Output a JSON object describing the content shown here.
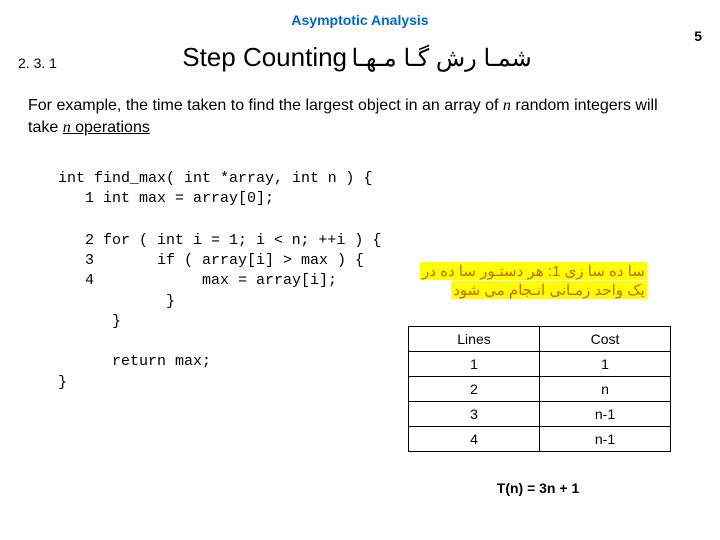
{
  "header": "Asymptotic Analysis",
  "page_number": "5",
  "section_number": "2. 3. 1",
  "title_en": "Step Counting",
  "title_fa": "شمـا رش گـا مـهـا",
  "body_prefix": "For example, the time taken to find the largest object in an array of ",
  "body_italic1": "n",
  "body_mid": " random integers will take ",
  "body_italic2": "n",
  "body_suffix": " operations",
  "code": {
    "l0a": "int find_max( int *array, int ",
    "l0n": "n",
    "l0b": " ) {",
    "l1": "   1 int max = array[0];",
    "blank1": "",
    "l2a": "   2 for ( int i = 1; i < ",
    "l2n": "n",
    "l2b": "; ++i ) {",
    "l3": "   3       if ( array[i] > max ) {",
    "l4": "   4            max = array[i];",
    "l5": "            }",
    "l6": "      }",
    "blank2": "",
    "l7": "      return max;",
    "l8": "}"
  },
  "annot_line1": "سا ده سا زی 1:  هر دستـور سا ده در",
  "annot_line2": "یک واحد زمـانی انـجام می شود",
  "table": {
    "h1": "Lines",
    "h2": "Cost",
    "rows": [
      [
        "1",
        "1"
      ],
      [
        "2",
        "n"
      ],
      [
        "3",
        "n-1"
      ],
      [
        "4",
        "n-1"
      ]
    ]
  },
  "tn": "T(n) = 3n + 1"
}
